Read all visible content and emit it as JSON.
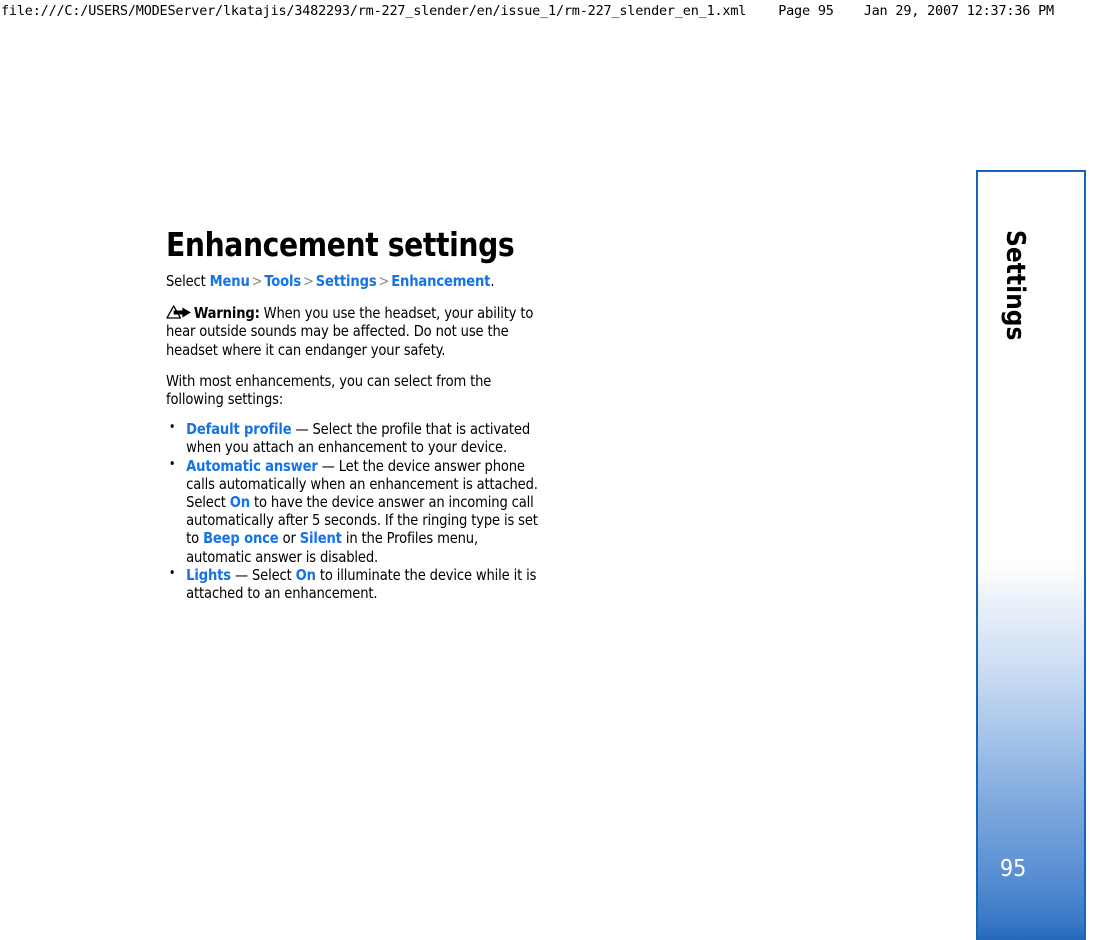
{
  "print_header": {
    "file_path": "file:///C:/USERS/MODEServer/lkatajis/3482293/rm-227_slender/en/issue_1/rm-227_slender_en_1.xml",
    "page_label": "Page 95",
    "timestamp": "Jan 29, 2007 12:37:36 PM"
  },
  "page": {
    "title": "Enhancement settings",
    "breadcrumb": {
      "lead": "Select ",
      "items": [
        "Menu",
        "Tools",
        "Settings",
        "Enhancement"
      ],
      "separator": ">",
      "trailing": "."
    },
    "warning": {
      "icon": "warning-triangle-arrow-icon",
      "label": "Warning:",
      "text": "When you use the headset, your ability to hear outside sounds may be affected. Do not use the headset where it can endanger your safety."
    },
    "intro": "With most enhancements, you can select from the following settings:",
    "bullets": [
      {
        "term": "Default profile",
        "parts": [
          {
            "t": " — Select the profile that is activated when you attach an enhancement to your device.",
            "link": false
          }
        ]
      },
      {
        "term": "Automatic answer",
        "parts": [
          {
            "t": " — Let the device answer phone calls automatically when an enhancement is attached. Select ",
            "link": false
          },
          {
            "t": "On",
            "link": true
          },
          {
            "t": " to have the device answer an incoming call automatically after 5 seconds. If the ringing type is set to ",
            "link": false
          },
          {
            "t": "Beep once",
            "link": true
          },
          {
            "t": " or ",
            "link": false
          },
          {
            "t": "Silent",
            "link": true
          },
          {
            "t": " in the Profiles menu, automatic answer is disabled.",
            "link": false
          }
        ]
      },
      {
        "term": "Lights",
        "parts": [
          {
            "t": " — Select ",
            "link": false
          },
          {
            "t": "On",
            "link": true
          },
          {
            "t": " to illuminate the device while it is attached to an enhancement.",
            "link": false
          }
        ]
      }
    ]
  },
  "side_tab": {
    "label": "Settings",
    "page_number": "95"
  },
  "colors": {
    "link": "#1673e6",
    "tab_border": "#1565b8",
    "tab_gradient_end": "#2167b8",
    "separator": "#8d8d8d"
  }
}
